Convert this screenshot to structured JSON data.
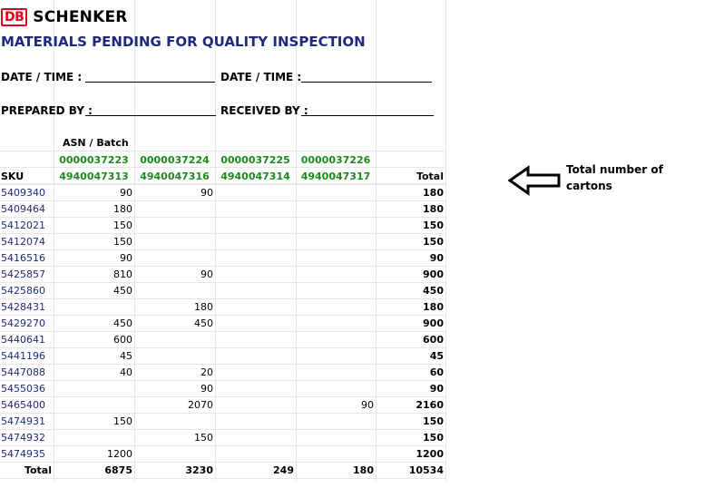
{
  "header": {
    "logo_db": "DB",
    "logo_name": "SCHENKER",
    "title": "MATERIALS PENDING FOR QUALITY INSPECTION"
  },
  "signatures": {
    "date_time_1": "DATE / TIME   :",
    "date_time_2": "DATE / TIME :",
    "prepared_by": "PREPARED BY :",
    "received_by": "RECEIVED BY :"
  },
  "table": {
    "asn_batch_label": "ASN / Batch",
    "sku_label": "SKU",
    "total_label": "Total",
    "asn_numbers": [
      "0000037223",
      "0000037224",
      "0000037225",
      "0000037226"
    ],
    "batch_numbers": [
      "4940047313",
      "4940047316",
      "4940047314",
      "4940047317"
    ],
    "rows": [
      {
        "sku": "5409340",
        "values": [
          "90",
          "90",
          "",
          ""
        ],
        "total": "180"
      },
      {
        "sku": "5409464",
        "values": [
          "180",
          "",
          "",
          ""
        ],
        "total": "180"
      },
      {
        "sku": "5412021",
        "values": [
          "150",
          "",
          "",
          ""
        ],
        "total": "150"
      },
      {
        "sku": "5412074",
        "values": [
          "150",
          "",
          "",
          ""
        ],
        "total": "150"
      },
      {
        "sku": "5416516",
        "values": [
          "90",
          "",
          "",
          ""
        ],
        "total": "90"
      },
      {
        "sku": "5425857",
        "values": [
          "810",
          "90",
          "",
          ""
        ],
        "total": "900"
      },
      {
        "sku": "5425860",
        "values": [
          "450",
          "",
          "",
          ""
        ],
        "total": "450"
      },
      {
        "sku": "5428431",
        "values": [
          "",
          "180",
          "",
          ""
        ],
        "total": "180"
      },
      {
        "sku": "5429270",
        "values": [
          "450",
          "450",
          "",
          ""
        ],
        "total": "900"
      },
      {
        "sku": "5440641",
        "values": [
          "600",
          "",
          "",
          ""
        ],
        "total": "600"
      },
      {
        "sku": "5441196",
        "values": [
          "45",
          "",
          "",
          ""
        ],
        "total": "45"
      },
      {
        "sku": "5447088",
        "values": [
          "40",
          "20",
          "",
          ""
        ],
        "total": "60"
      },
      {
        "sku": "5455036",
        "values": [
          "",
          "90",
          "",
          ""
        ],
        "total": "90"
      },
      {
        "sku": "5465400",
        "values": [
          "",
          "2070",
          "",
          "90"
        ],
        "total": "2160"
      },
      {
        "sku": "5474931",
        "values": [
          "150",
          "",
          "",
          ""
        ],
        "total": "150"
      },
      {
        "sku": "5474932",
        "values": [
          "",
          "150",
          "",
          ""
        ],
        "total": "150"
      },
      {
        "sku": "5474935",
        "values": [
          "1200",
          "",
          "",
          ""
        ],
        "total": "1200"
      }
    ],
    "footer": {
      "label": "Total",
      "values": [
        "6875",
        "3230",
        "249",
        "180"
      ],
      "total": "10534"
    }
  },
  "annotation": {
    "icon": "left-arrow-icon",
    "text_line1": "Total number of",
    "text_line2": "cartons"
  }
}
